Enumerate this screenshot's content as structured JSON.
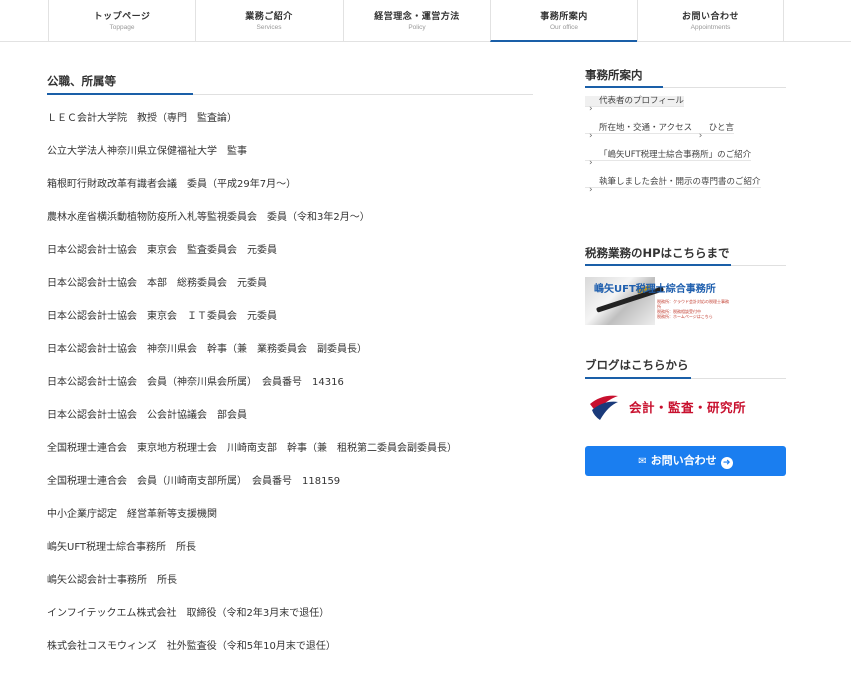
{
  "nav": {
    "items": [
      {
        "label": "トップページ",
        "sub": "Toppage"
      },
      {
        "label": "業務ご紹介",
        "sub": "Services"
      },
      {
        "label": "経営理念・運営方法",
        "sub": "Policy"
      },
      {
        "label": "事務所案内",
        "sub": "Our office"
      },
      {
        "label": "お問い合わせ",
        "sub": "Appointments"
      }
    ]
  },
  "main": {
    "title": "公職、所属等",
    "items": [
      "ＬＥＣ会計大学院　教授（専門　監査論）",
      "公立大学法人神奈川県立保健福祉大学　監事",
      "箱根町行財政改革有識者会議　委員（平成29年7月～）",
      "農林水産省横浜動植物防疫所入札等監視委員会　委員（令和3年2月～）",
      "日本公認会計士協会　東京会　監査委員会　元委員",
      "日本公認会計士協会　本部　総務委員会　元委員",
      "日本公認会計士協会　東京会　ＩＴ委員会　元委員",
      "日本公認会計士協会　神奈川県会　幹事（兼　業務委員会　副委員長）",
      "日本公認会計士協会　会員（神奈川県会所属）　会員番号　14316",
      "日本公認会計士協会　公会計協議会　部会員",
      "全国税理士連合会　東京地方税理士会　川崎南支部　幹事（兼　租税第二委員会副委員長）",
      "全国税理士連合会　会員（川崎南支部所属）　会員番号　118159",
      "中小企業庁認定　経営革新等支援機関",
      "嶋矢UFT税理士綜合事務所　所長",
      "嶋矢公認会計士事務所　所長",
      "インフイテックエム株式会社　取締役（令和2年3月末で退任）",
      "株式会社コスモウィンズ　社外監査役（令和5年10月末で退任）"
    ]
  },
  "sidebar": {
    "office_heading": "事務所案内",
    "menu": [
      "代表者のプロフィール",
      "所在地・交通・アクセス",
      "ひと言",
      "「嶋矢UFT税理士綜合事務所」のご紹介",
      "執筆しました会計・開示の専門書のご紹介"
    ],
    "hp_heading": "税務業務のHPはこちらまで",
    "banner_title": "嶋矢UFT税理士綜合事務所",
    "banner_lines": [
      "税務所：クラウド会計対応の税理士事務所",
      "税務所：税務相談受付中",
      "税務所：ホームページはこちら"
    ],
    "blog_heading": "ブログはこちらから",
    "blog_text": "会計・監査・研究所",
    "contact_label": "お問い合わせ"
  },
  "colors": {
    "accent": "#1a5fa8",
    "button": "#1a7ef0",
    "blog_red": "#c8102e"
  }
}
